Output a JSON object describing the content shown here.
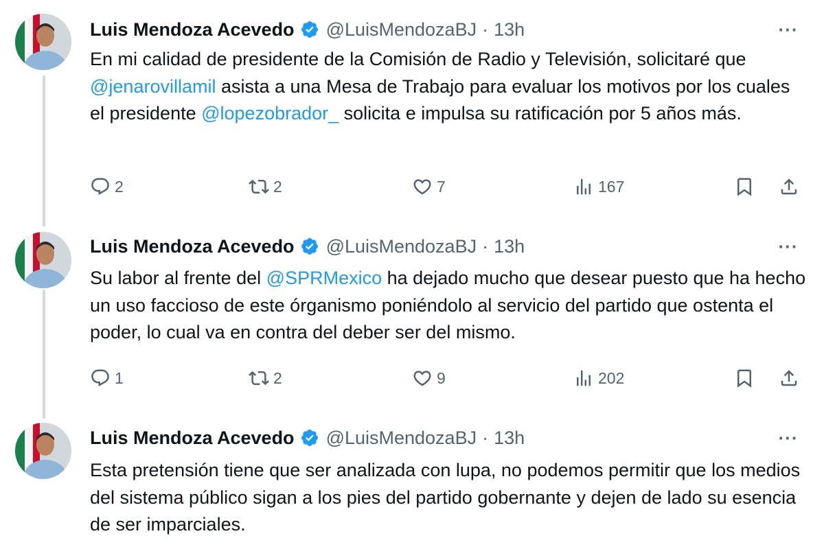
{
  "tweets": [
    {
      "author_name": "Luis Mendoza Acevedo",
      "handle": "@LuisMendozaBJ",
      "separator": "·",
      "time": "13h",
      "more_label": "···",
      "body": [
        {
          "text": "En mi calidad de presidente de la Comisión de Radio y Televisión, solicitaré que "
        },
        {
          "text": "@jenarovillamil",
          "link": true
        },
        {
          "text": " asista a una Mesa de Trabajo para evaluar los motivos por los cuales el presidente "
        },
        {
          "text": "@lopezobrador_",
          "link": true
        },
        {
          "text": " solicita e impulsa su ratificación por 5 años más."
        }
      ],
      "replies": "2",
      "retweets": "2",
      "likes": "7",
      "views": "167"
    },
    {
      "author_name": "Luis Mendoza Acevedo",
      "handle": "@LuisMendozaBJ",
      "separator": "·",
      "time": "13h",
      "more_label": "···",
      "body": [
        {
          "text": "Su labor al frente del "
        },
        {
          "text": "@SPRMexico",
          "link": true
        },
        {
          "text": " ha dejado mucho que desear puesto que ha hecho un uso faccioso de este órganismo poniéndolo al servicio del partido que ostenta el poder, lo cual va en contra del deber ser del mismo."
        }
      ],
      "replies": "1",
      "retweets": "2",
      "likes": "9",
      "views": "202"
    },
    {
      "author_name": "Luis Mendoza Acevedo",
      "handle": "@LuisMendozaBJ",
      "separator": "·",
      "time": "13h",
      "more_label": "···",
      "body": [
        {
          "text": "Esta pretensión tiene que ser analizada con lupa, no podemos permitir que los medios del sistema público sigan a los pies del partido gobernante y dejen de lado su esencia de ser imparciales."
        }
      ]
    }
  ],
  "colors": {
    "text": "#0f1419",
    "secondary": "#536471",
    "link": "#1d9bf0",
    "verified": "#1d9bf0",
    "thread_line": "#cfd9de"
  },
  "icons": {
    "reply": "reply-icon",
    "retweet": "retweet-icon",
    "like": "like-icon",
    "views": "views-icon",
    "bookmark": "bookmark-icon",
    "share": "share-icon",
    "verified": "verified-badge-icon",
    "more": "more-icon"
  }
}
